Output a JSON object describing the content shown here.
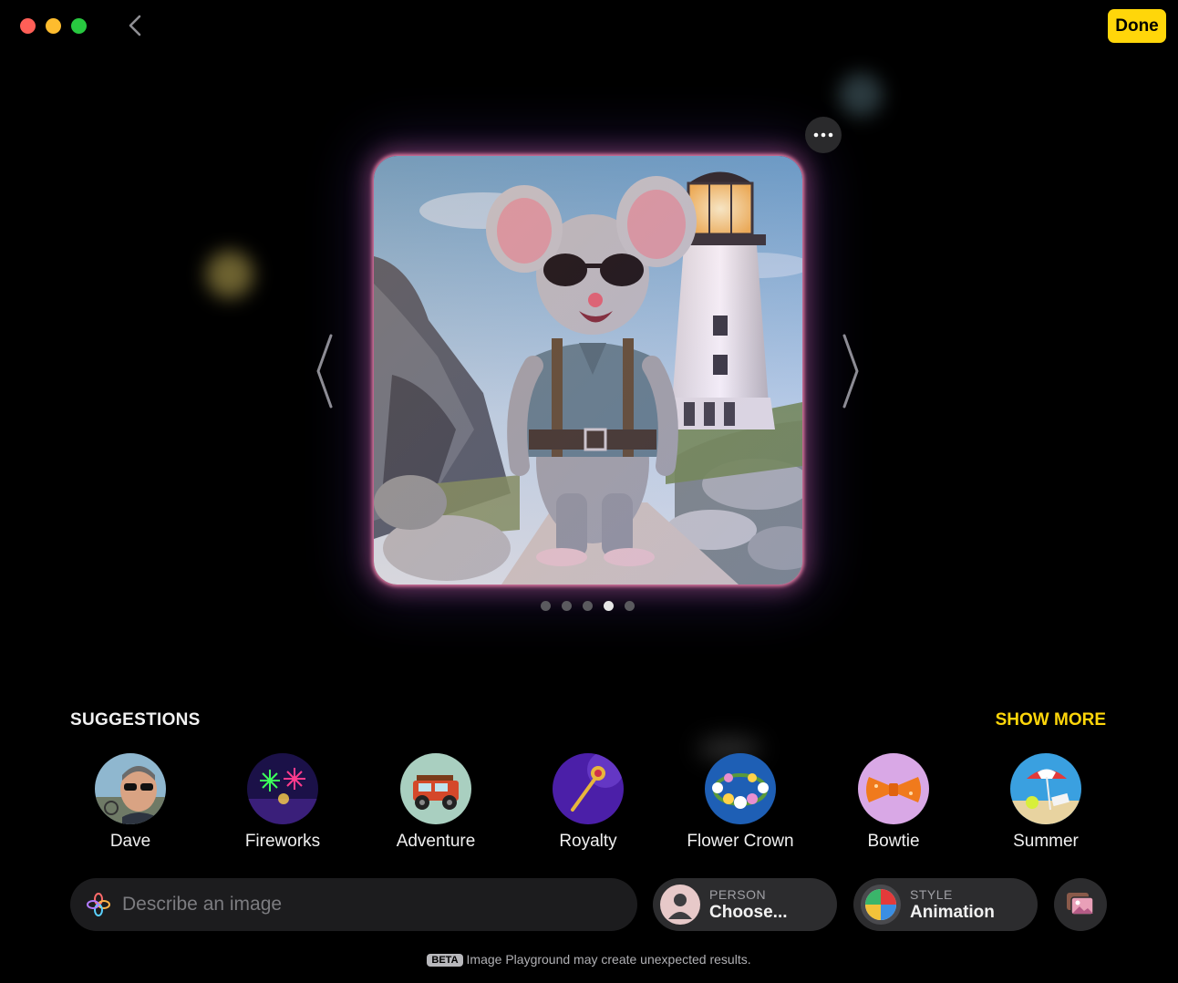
{
  "header": {
    "done_label": "Done"
  },
  "carousel": {
    "page_count": 5,
    "current_page": 4
  },
  "suggestions": {
    "title": "SUGGESTIONS",
    "show_more": "SHOW MORE",
    "items": [
      {
        "label": "Dave",
        "icon": "person-photo"
      },
      {
        "label": "Fireworks",
        "icon": "fireworks-icon"
      },
      {
        "label": "Adventure",
        "icon": "jeep-icon"
      },
      {
        "label": "Royalty",
        "icon": "scepter-icon"
      },
      {
        "label": "Flower Crown",
        "icon": "flower-crown-icon"
      },
      {
        "label": "Bowtie",
        "icon": "bowtie-icon"
      },
      {
        "label": "Summer",
        "icon": "beach-umbrella-icon"
      }
    ]
  },
  "prompt": {
    "placeholder": "Describe an image"
  },
  "person": {
    "caption": "PERSON",
    "value": "Choose..."
  },
  "style": {
    "caption": "STYLE",
    "value": "Animation"
  },
  "footer": {
    "badge": "BETA",
    "text": "Image Playground may create unexpected results."
  },
  "colors": {
    "accent": "#ffd60a",
    "background": "#000000"
  }
}
